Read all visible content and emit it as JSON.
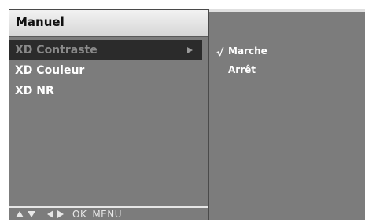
{
  "menu": {
    "title": "Manuel",
    "items": [
      {
        "label": "XD Contraste",
        "selected": true
      },
      {
        "label": "XD Couleur",
        "selected": false
      },
      {
        "label": "XD NR",
        "selected": false
      }
    ]
  },
  "footer": {
    "ok": "OK",
    "menu": "MENU"
  },
  "submenu": {
    "options": [
      {
        "label": "Marche",
        "checked": true
      },
      {
        "label": "Arrêt",
        "checked": false
      }
    ],
    "check_mark": "√"
  }
}
